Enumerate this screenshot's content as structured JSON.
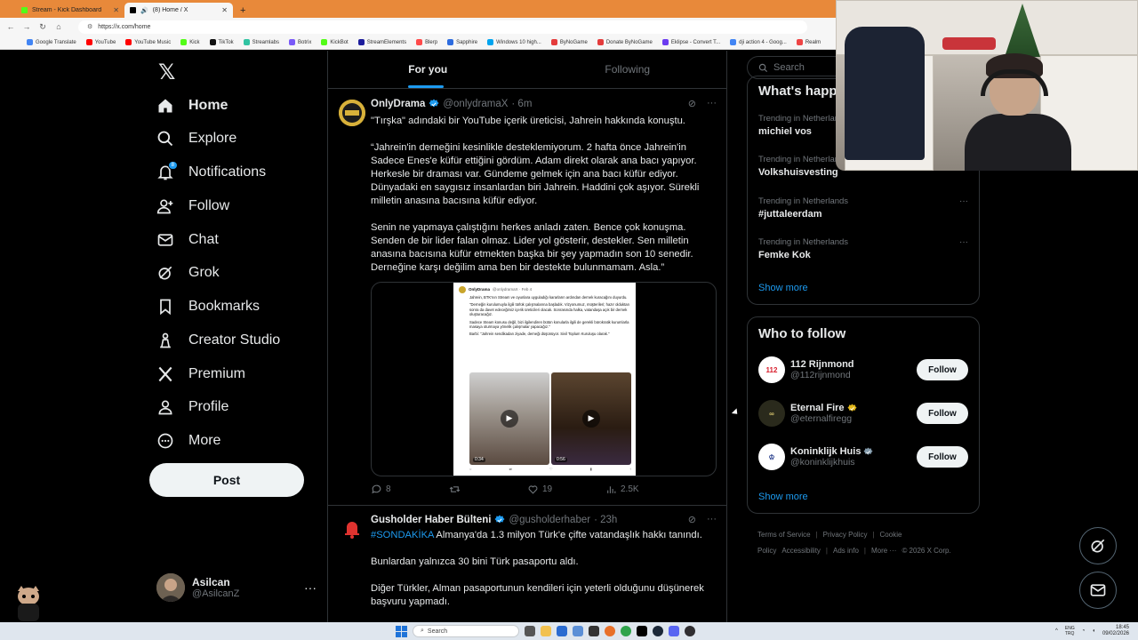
{
  "browser": {
    "tabs": [
      {
        "title": "Stream - Kick Dashboard",
        "color": "#53fc18",
        "active": false
      },
      {
        "title": "(8) Home / X",
        "color": "#000000",
        "active": true
      }
    ],
    "url": "https://x.com/home",
    "bookmarks": [
      {
        "label": "Google Translate",
        "color": "#4285f4"
      },
      {
        "label": "YouTube",
        "color": "#ff0000"
      },
      {
        "label": "YouTube Music",
        "color": "#ff0000"
      },
      {
        "label": "Kick",
        "color": "#53fc18"
      },
      {
        "label": "TikTok",
        "color": "#111111"
      },
      {
        "label": "Streamlabs",
        "color": "#31c3a2"
      },
      {
        "label": "Botrix",
        "color": "#7a5af8"
      },
      {
        "label": "KickBot",
        "color": "#53fc18"
      },
      {
        "label": "StreamElements",
        "color": "#1d1d9c"
      },
      {
        "label": "Blerp",
        "color": "#ff4a4a"
      },
      {
        "label": "Sapphire",
        "color": "#2d6cdf"
      },
      {
        "label": "Windows 10 high...",
        "color": "#00a4ef"
      },
      {
        "label": "ByNoGame",
        "color": "#e43c3c"
      },
      {
        "label": "Donate ByNoGame",
        "color": "#e43c3c"
      },
      {
        "label": "Eklipse - Convert T...",
        "color": "#6c3cf0"
      },
      {
        "label": "dji action 4 - Goog...",
        "color": "#4285f4"
      },
      {
        "label": "Realm",
        "color": "#e44"
      }
    ]
  },
  "sidebar": {
    "items": [
      {
        "label": "Home",
        "icon": "home-icon",
        "bold": true
      },
      {
        "label": "Explore",
        "icon": "search-icon"
      },
      {
        "label": "Notifications",
        "icon": "bell-icon",
        "badge": "8"
      },
      {
        "label": "Follow",
        "icon": "person-plus-icon"
      },
      {
        "label": "Chat",
        "icon": "envelope-icon"
      },
      {
        "label": "Grok",
        "icon": "grok-icon"
      },
      {
        "label": "Bookmarks",
        "icon": "bookmark-icon"
      },
      {
        "label": "Creator Studio",
        "icon": "creator-studio-icon"
      },
      {
        "label": "Premium",
        "icon": "x-logo-icon"
      },
      {
        "label": "Profile",
        "icon": "person-icon"
      },
      {
        "label": "More",
        "icon": "more-circle-icon"
      }
    ],
    "post_label": "Post",
    "account": {
      "name": "Asilcan",
      "handle": "@AsilcanZ",
      "more": "···"
    }
  },
  "timeline": {
    "tabs": [
      "For you",
      "Following"
    ],
    "tweet1": {
      "name": "OnlyDrama",
      "handle": "@onlydramaX",
      "time": "· 6m",
      "paragraphs": [
        "\"Tırşka\" adındaki bir YouTube içerik üreticisi, Jahrein hakkında konuştu.",
        "“Jahrein'in derneğini kesinlikle desteklemiyorum. 2 hafta önce Jahrein'in Sadece Enes'e küfür ettiğini gördüm. Adam direkt olarak ana bacı yapıyor. Herkesle bir draması var. Gündeme gelmek için ana bacı küfür ediyor. Dünyadaki en saygısız insanlardan biri Jahrein. Haddini çok aşıyor. Sürekli milletin anasına bacısına küfür ediyor.",
        "Senin ne yapmaya çalıştığını herkes anladı zaten. Bence çok konuşma. Senden de bir lider falan olmaz. Lider yol gösterir, destekler. Sen milletin anasına bacısına küfür etmekten başka bir şey yapmadın son 10 senedir. Derneğine karşı değilim ama ben bir destekte bulunmamam. Asla.”"
      ],
      "media": {
        "name": "OnlyDrama",
        "handle": "@onlydramaX · Feb 4",
        "paragraphs": [
          "Jahrein, BTK'nın Stream ve oyunlara uyguladığı kararların ardından dernek kuracağını duyurdu.",
          "\"Derneğin kurulumuyla ilgili türlük çalışmalarına başladık. Vizyonumuz, müşterileri; hazır olduktan sonra da davet edeceğimiz içerik üreticileri olacak. Sonrasında halka, vatandaşa açık bir dernek oluşturacağız.",
          "Sadece Steam konusu değil, bizi ilgilendiren bütün konularla ilgili de gerekli bürokratik kurumlarla masaya oturmaya yönelik çalışmalar yapacağız.\"",
          "Barbi: \"Jahrein sendikadan ziyade, derneği düşünüyor. Sivil Toplum Kuruluşu olarak.\""
        ],
        "video1_time": "0:34",
        "video2_time": "0:56"
      },
      "replies": "8",
      "reposts": "",
      "likes": "19",
      "views": "2.5K"
    },
    "tweet2": {
      "name": "Gusholder Haber Bülteni",
      "handle": "@gusholderhaber",
      "time": "· 23h",
      "hashtag": "#SONDAKİKA",
      "line1": " Almanya'da 1.3 milyon Türk'e çifte vatandaşlık hakkı tanındı.",
      "line2": "Bunlardan yalnızca 30 bini Türk pasaportu aldı.",
      "line3": "Diğer Türkler, Alman pasaportunun kendileri için yeterli olduğunu düşünerek başvuru yapmadı."
    }
  },
  "right": {
    "search_placeholder": "Search",
    "trends_title": "What's happening",
    "trends": [
      {
        "context": "Trending in Netherlands",
        "name": "michiel vos"
      },
      {
        "context": "Trending in Netherlands",
        "name": "Volkshuisvesting"
      },
      {
        "context": "Trending in Netherlands",
        "name": "#juttaleerdam"
      },
      {
        "context": "Trending in Netherlands",
        "name": "Femke Kok"
      }
    ],
    "show_more": "Show more",
    "wtf_title": "Who to follow",
    "who_to_follow": [
      {
        "name": "112 Rijnmond",
        "handle": "@112rijnmond",
        "verified": false,
        "avatar_text": "112",
        "avatar_color": "#ffffff",
        "text_color": "#d81e2c"
      },
      {
        "name": "Eternal Fire",
        "handle": "@eternalfiregg",
        "verified": true,
        "verified_color": "#e2b719",
        "avatar_text": "∞",
        "avatar_color": "#2a2a1c",
        "text_color": "#d4c26b"
      },
      {
        "name": "Koninklijk Huis",
        "handle": "@koninklijkhuis",
        "verified": true,
        "verified_color": "#829aab",
        "avatar_text": "♔",
        "avatar_color": "#ffffff",
        "text_color": "#233a8a"
      }
    ],
    "follow_label": "Follow",
    "footer": [
      "Terms of Service",
      "Privacy Policy",
      "Cookie Policy",
      "Accessibility",
      "Ads info",
      "More ···",
      "© 2026 X Corp."
    ]
  },
  "taskbar": {
    "search_placeholder": "Search",
    "lang": "ENG\nTRQ",
    "time": "18:45",
    "date": "09/02/2026"
  }
}
